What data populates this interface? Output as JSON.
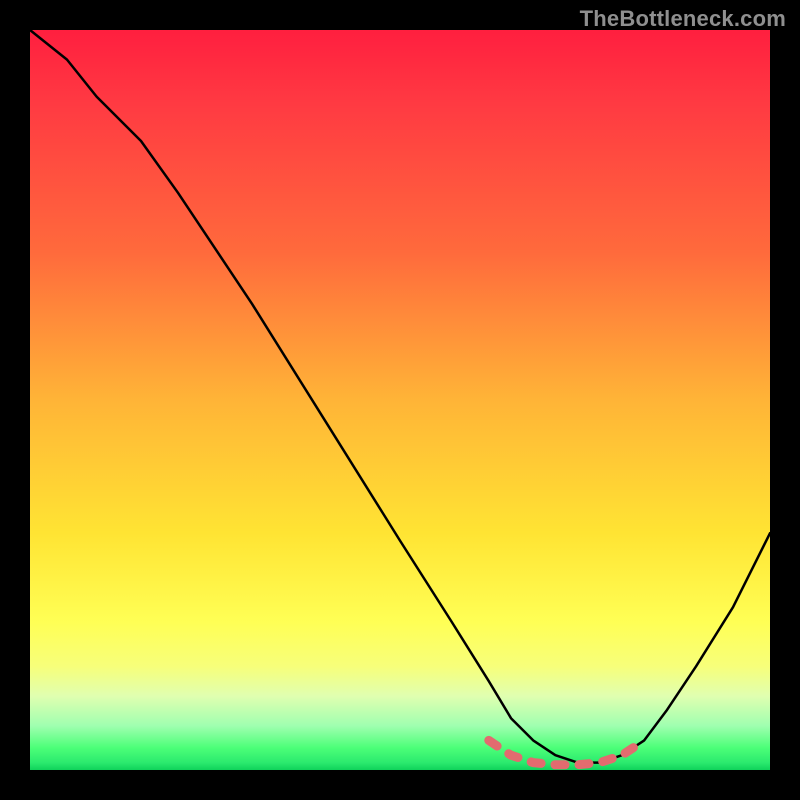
{
  "watermark": "TheBottleneck.com",
  "chart_data": {
    "type": "line",
    "title": "",
    "xlabel": "",
    "ylabel": "",
    "xlim": [
      0,
      100
    ],
    "ylim": [
      0,
      100
    ],
    "series": [
      {
        "name": "bottleneck-curve",
        "color": "#000000",
        "x": [
          0,
          5,
          9,
          15,
          20,
          30,
          40,
          50,
          57,
          62,
          65,
          68,
          71,
          74,
          77,
          80,
          83,
          86,
          90,
          95,
          100
        ],
        "y": [
          100,
          96,
          91,
          85,
          78,
          63,
          47,
          31,
          20,
          12,
          7,
          4,
          2,
          1,
          1,
          2,
          4,
          8,
          14,
          22,
          32
        ]
      },
      {
        "name": "optimum-band",
        "color": "#e26b6f",
        "x": [
          62,
          65,
          68,
          71,
          74,
          77,
          80,
          83
        ],
        "y": [
          4,
          2,
          1,
          0.7,
          0.7,
          1,
          2,
          4
        ]
      }
    ]
  }
}
